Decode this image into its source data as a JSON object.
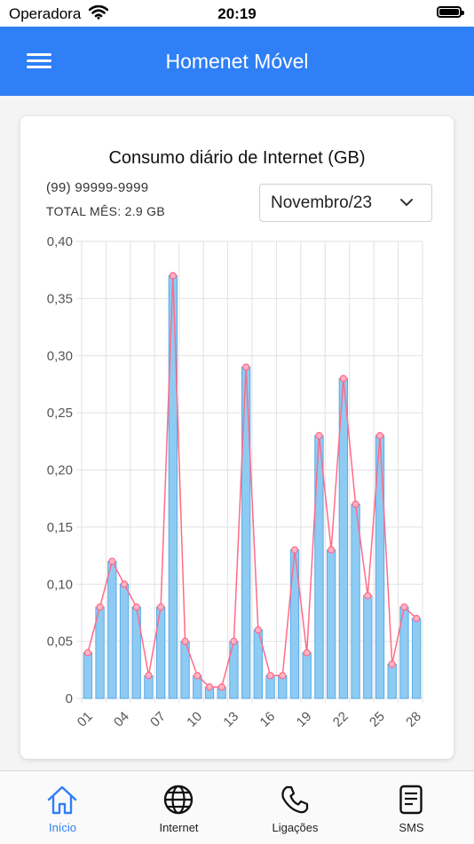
{
  "status_bar": {
    "carrier": "Operadora",
    "time": "20:19"
  },
  "header": {
    "title": "Homenet Móvel",
    "menu_icon": "hamburger-menu-icon"
  },
  "card": {
    "title": "Consumo diário de Internet (GB)",
    "phone": "(99) 99999-9999",
    "total_label": "TOTAL MÊS: 2.9 GB",
    "month_select": {
      "value": "Novembro/23"
    }
  },
  "chart_data": {
    "type": "bar",
    "title": "Consumo diário de Internet (GB)",
    "categories": [
      "01",
      "02",
      "03",
      "04",
      "05",
      "06",
      "07",
      "08",
      "09",
      "10",
      "11",
      "12",
      "13",
      "14",
      "15",
      "16",
      "17",
      "18",
      "19",
      "20",
      "21",
      "22",
      "23",
      "24",
      "25",
      "26",
      "27",
      "28"
    ],
    "x_tick_labels": [
      "01",
      "04",
      "07",
      "10",
      "13",
      "16",
      "19",
      "22",
      "25",
      "28"
    ],
    "values": [
      0.04,
      0.08,
      0.12,
      0.1,
      0.08,
      0.02,
      0.08,
      0.37,
      0.05,
      0.02,
      0.01,
      0.01,
      0.05,
      0.29,
      0.06,
      0.02,
      0.02,
      0.13,
      0.04,
      0.23,
      0.13,
      0.28,
      0.17,
      0.09,
      0.23,
      0.03,
      0.08,
      0.07
    ],
    "overlay_line": true,
    "y_tick_labels": [
      "0",
      "0,05",
      "0,10",
      "0,15",
      "0,20",
      "0,25",
      "0,30",
      "0,35",
      "0,40"
    ],
    "ylim": [
      0,
      0.4
    ],
    "grid": true,
    "colors": {
      "bar_fill": "#8ecbf3",
      "bar_stroke": "#5aa9e6",
      "line": "#ff6b8a",
      "point_fill": "#ffb3c3"
    }
  },
  "bottom_nav": {
    "items": [
      {
        "label": "Início",
        "icon": "home-icon",
        "active": true
      },
      {
        "label": "Internet",
        "icon": "globe-icon",
        "active": false
      },
      {
        "label": "Ligações",
        "icon": "phone-icon",
        "active": false
      },
      {
        "label": "SMS",
        "icon": "document-icon",
        "active": false
      }
    ]
  },
  "colors": {
    "primary": "#2f7ff6",
    "background": "#f4f4f4"
  }
}
